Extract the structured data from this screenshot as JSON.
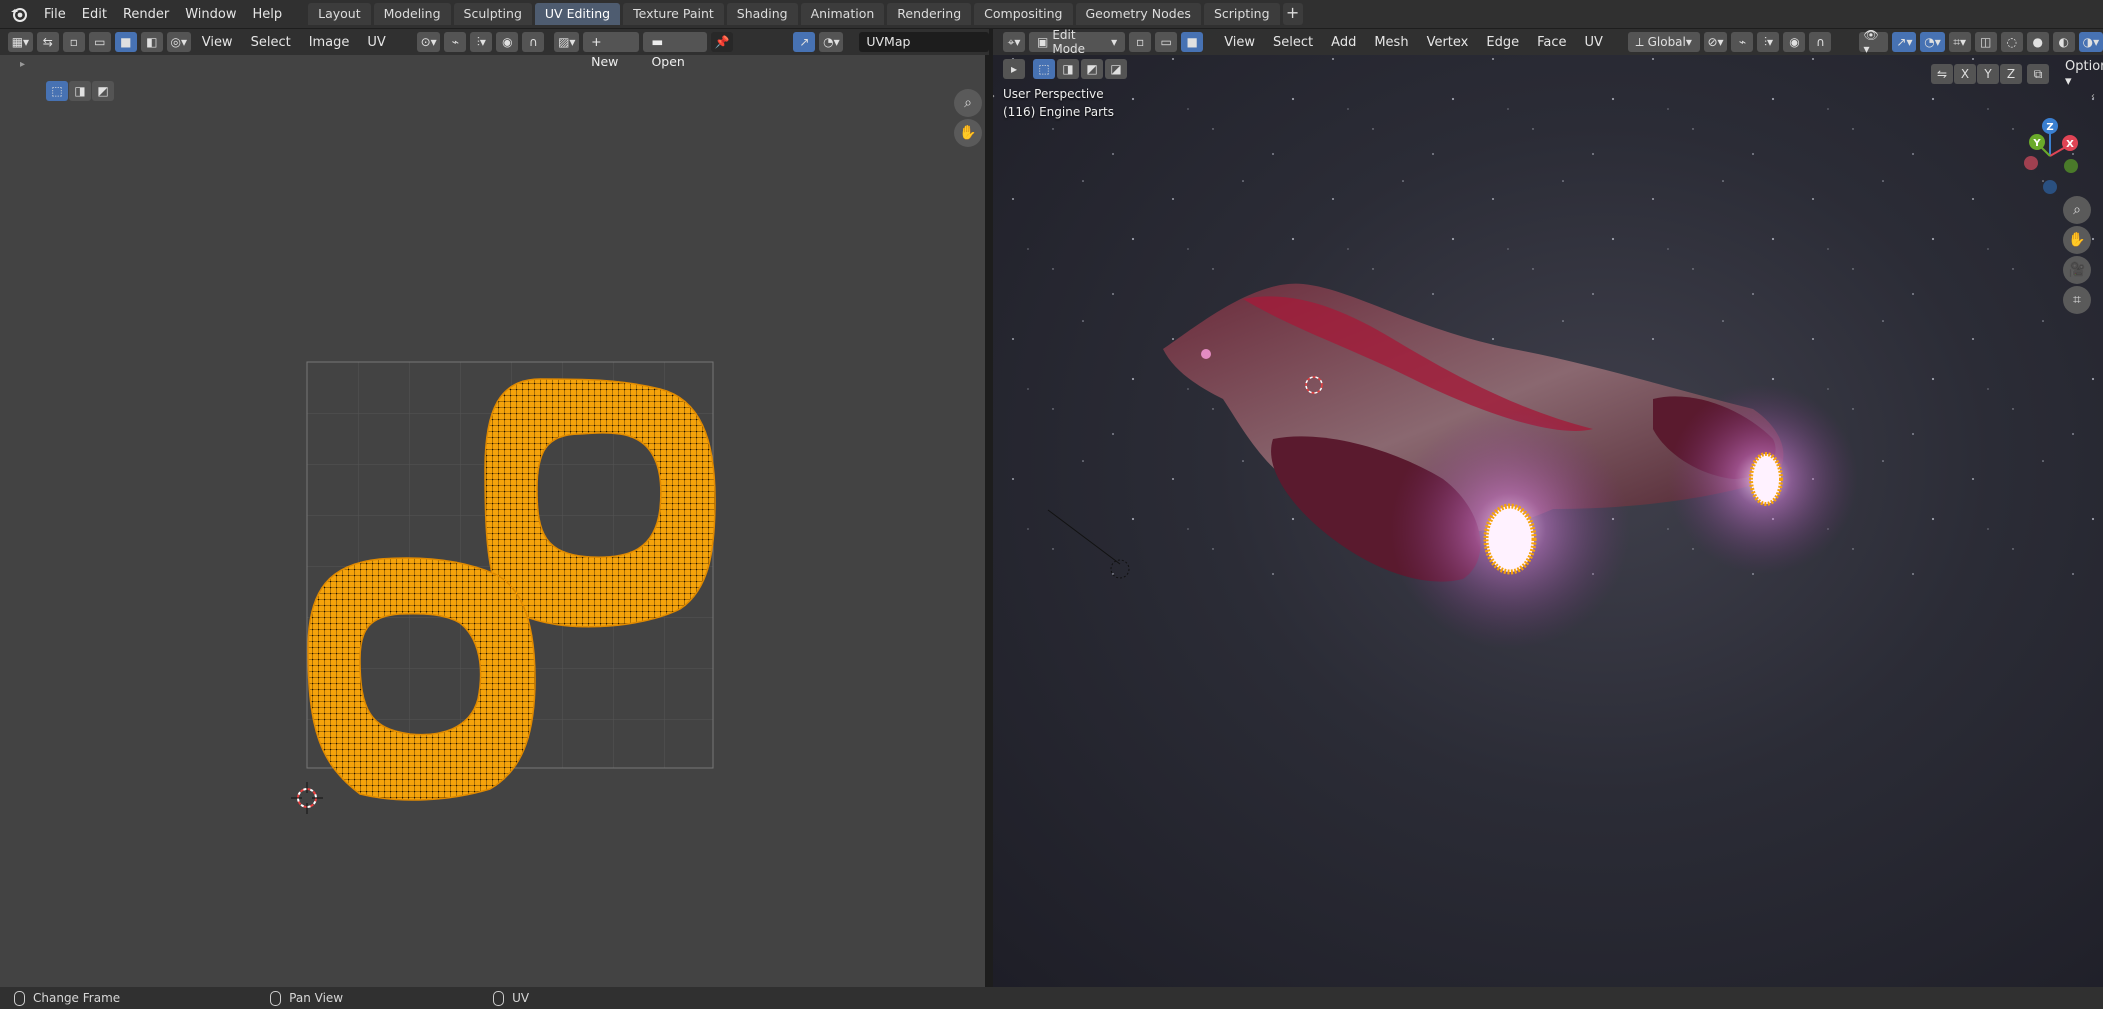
{
  "menubar": {
    "items": [
      "File",
      "Edit",
      "Render",
      "Window",
      "Help"
    ]
  },
  "workspaces": {
    "tabs": [
      "Layout",
      "Modeling",
      "Sculpting",
      "UV Editing",
      "Texture Paint",
      "Shading",
      "Animation",
      "Rendering",
      "Compositing",
      "Geometry Nodes",
      "Scripting"
    ],
    "active": "UV Editing",
    "add_label": "+"
  },
  "uv_editor": {
    "menus": [
      "View",
      "Select",
      "Image",
      "UV"
    ],
    "new_label": "New",
    "open_label": "Open",
    "uv_map": "UVMap",
    "selection_color": "#f5a30b"
  },
  "viewport": {
    "mode": "Edit Mode",
    "menus": [
      "View",
      "Select",
      "Add",
      "Mesh",
      "Vertex",
      "Edge",
      "Face",
      "UV"
    ],
    "orientation": "Global",
    "options_label": "Options",
    "axes_labels": [
      "X",
      "Y",
      "Z"
    ],
    "perspective": "User Perspective",
    "object_info": "(116) Engine Parts",
    "gizmo": {
      "x": "X",
      "y": "Y",
      "z": "Z"
    }
  },
  "statusbar": {
    "items": [
      {
        "icon": "mouse-left-icon",
        "label": "Change Frame"
      },
      {
        "icon": "mouse-middle-icon",
        "label": "Pan View"
      },
      {
        "icon": "mouse-right-icon",
        "label": "UV"
      }
    ]
  }
}
